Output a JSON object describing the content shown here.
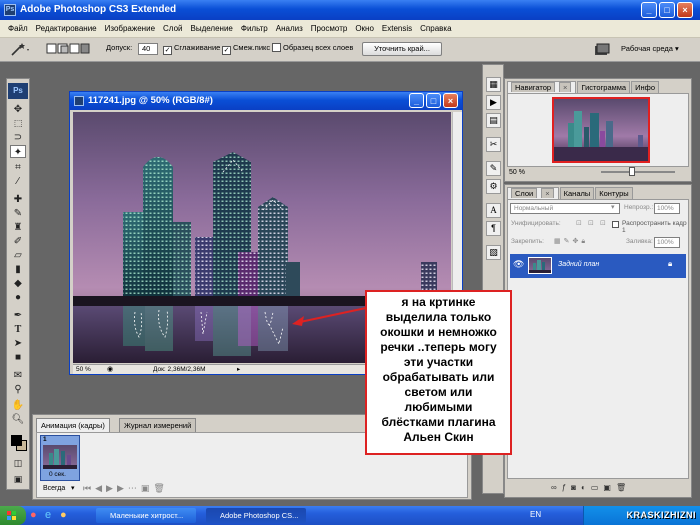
{
  "window": {
    "title": "Adobe Photoshop CS3 Extended"
  },
  "menu": [
    "Файл",
    "Редактирование",
    "Изображение",
    "Слой",
    "Выделение",
    "Фильтр",
    "Анализ",
    "Просмотр",
    "Окно",
    "Extensis",
    "Справка"
  ],
  "options": {
    "tolerance_label": "Допуск:",
    "tolerance_value": "40",
    "antialias_label": "Сглаживание",
    "contiguous_label": "Смеж.пикс",
    "all_layers_label": "Образец всех слоев",
    "refine_edge_label": "Уточнить край...",
    "workspace_label": "Рабочая среда"
  },
  "document": {
    "title": "117241.jpg @ 50% (RGB/8#)",
    "zoom": "50 %",
    "doc_size": "Док: 2,36М/2,36М"
  },
  "animation_panel": {
    "tabs": [
      "Анимация (кадры)",
      "Журнал измерений"
    ],
    "frame_number": "1",
    "frame_delay": "0 сек.",
    "loop": "Всегда"
  },
  "navigator_panel": {
    "tabs": [
      "Навигатор",
      "Гистограмма",
      "Инфо"
    ],
    "zoom": "50 %"
  },
  "layers_panel": {
    "tabs": [
      "Слои",
      "Каналы",
      "Контуры"
    ],
    "blend_mode": "Нормальный",
    "opacity_label": "Непрозр.:",
    "opacity_value": "100%",
    "unify_label": "Унифицировать:",
    "propagate_label": "Распространить кадр 1",
    "lock_label": "Закрепить:",
    "fill_label": "Заливка:",
    "fill_value": "100%",
    "layers": [
      {
        "name": "Задний план"
      }
    ]
  },
  "annotation": {
    "text": "я на кртинке выделила только окошки и немножко речки ..теперь могу эти участки обрабатывать или светом или любимыми блёстками плагина Альен Скин"
  },
  "taskbar": {
    "items": [
      "Маленькие хитрост...",
      "Adobe Photoshop CS..."
    ],
    "language": "EN",
    "watermark": "KRASKIZHIZNI"
  },
  "colors": {
    "xp_blue": "#0a4fd6",
    "panel_gray": "#d4d0c8",
    "callout_border": "#d22222",
    "layer_selected": "#2a5ac0"
  }
}
